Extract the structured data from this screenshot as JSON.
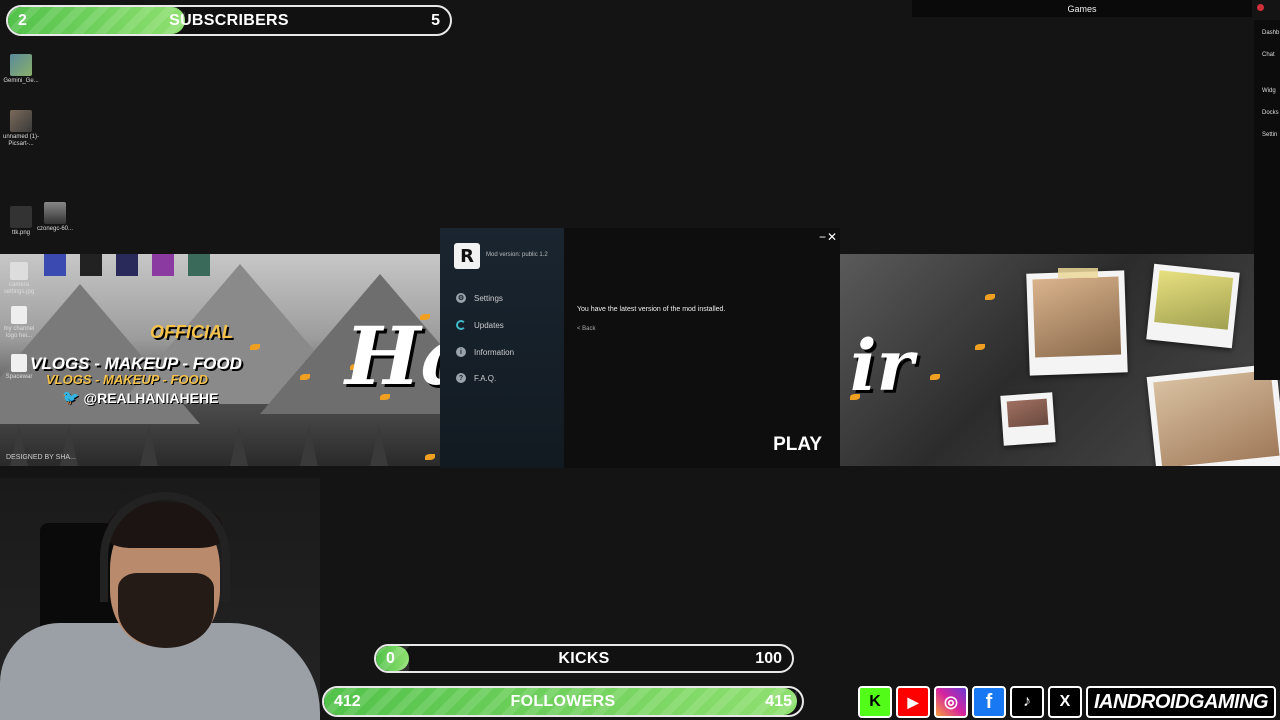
{
  "subscribers_bar": {
    "current": "2",
    "label": "SUBSCRIBERS",
    "goal": "5",
    "progress": 0.4
  },
  "kicks_bar": {
    "current": "0",
    "label": "KICKS",
    "goal": "100",
    "progress": 0.0
  },
  "followers_bar": {
    "current": "412",
    "label": "FOLLOWERS",
    "goal": "415",
    "progress": 0.99
  },
  "desktop_icons": [
    {
      "label": "Gemini_Ge...",
      "color": "#5a8a9a"
    },
    {
      "label": "unnamed (1)-Picsart-...",
      "color": "#7a6a5a"
    },
    {
      "label": "ttk.png",
      "color": "#333333"
    },
    {
      "label": "czonegc-60...",
      "color": "#6a6a7a"
    },
    {
      "label": "camera settings.jpg",
      "color": "#dddddd"
    },
    {
      "label": "my channel logo hei...",
      "color": "#eeeeee"
    },
    {
      "label": "Spacewar",
      "color": "#f0f0f0"
    }
  ],
  "banner_left": {
    "handle_line": "@REALHANIAHEHE",
    "tagline": "VLOGS - MAKEUP - FOOD",
    "channel": "OFFICIAL",
    "credit": "DESIGNED BY SHA..."
  },
  "launcher": {
    "logo": "R",
    "version": "Mod version: public 1.2",
    "menu": [
      {
        "label": "Settings",
        "icon": "gear-icon"
      },
      {
        "label": "Updates",
        "icon": "refresh-icon"
      },
      {
        "label": "Information",
        "icon": "info-icon"
      },
      {
        "label": "F.A.Q.",
        "icon": "question-icon"
      }
    ],
    "message": "You have the latest version of the mod installed.",
    "back": "< Back",
    "play": "PLAY",
    "minimize": "−",
    "close": "✕"
  },
  "obs": {
    "games_tab": "Games",
    "side_items": [
      "Dashb",
      "Chat",
      "Widg",
      "Docks",
      "Settin"
    ]
  },
  "socials": {
    "kick": "K",
    "youtube": "▶",
    "instagram": "◎",
    "facebook": "f",
    "tiktok": "♪",
    "x": "X",
    "handle": "IANDROIDGAMING"
  },
  "colors": {
    "bar_fill": "#52c24a",
    "launcher_accent": "#3fb8c8",
    "kick_green": "#53fc18",
    "youtube_red": "#ff0000",
    "facebook_blue": "#1877f2"
  }
}
